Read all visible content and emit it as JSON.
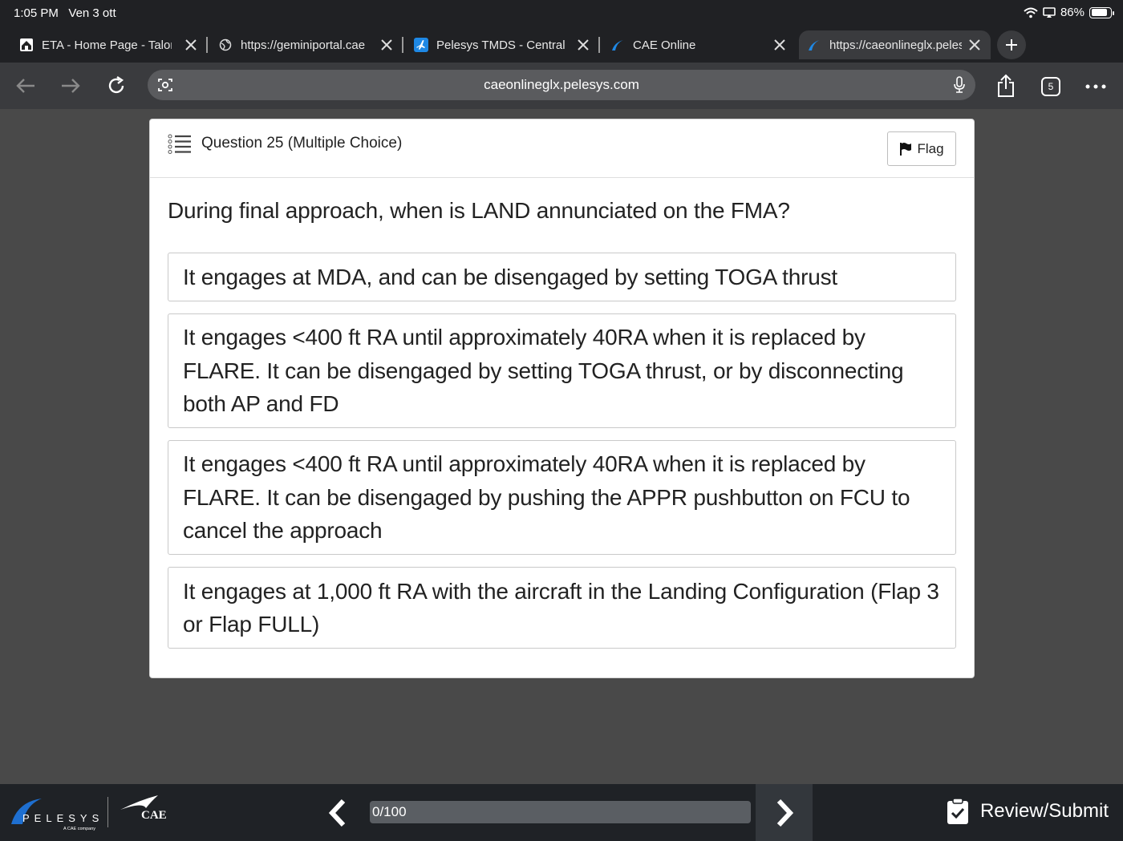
{
  "status_bar": {
    "time": "1:05 PM",
    "date": "Ven 3 ott",
    "battery": "86%",
    "battery_level": 0.86
  },
  "tabs": [
    {
      "title": "ETA - Home Page - Talon",
      "icon": "home-icon",
      "active": false
    },
    {
      "title": "https://geminiportal.cae",
      "icon": "globe-icon",
      "active": false
    },
    {
      "title": "Pelesys TMDS - Central",
      "icon": "plane-icon",
      "active": false
    },
    {
      "title": "CAE Online",
      "icon": "pelesys-icon",
      "active": false
    },
    {
      "title": "https://caeonlineglx.pelesys.com",
      "icon": "pelesys-icon",
      "active": true
    }
  ],
  "toolbar": {
    "url": "caeonlineglx.pelesys.com",
    "tab_count": "5"
  },
  "question": {
    "title": "Question 25 (Multiple Choice)",
    "flag_label": "Flag",
    "text": "During final approach, when is LAND annunciated on the FMA?",
    "options": [
      "It engages at MDA, and can be disengaged by setting TOGA thrust",
      "It engages <400 ft RA until approximately 40RA when it is replaced by FLARE. It can be disengaged by setting TOGA thrust, or by disconnecting both AP and FD",
      "It engages <400 ft RA until approximately 40RA when it is replaced by FLARE. It can be disengaged by pushing the APPR pushbutton on FCU to cancel the approach",
      "It engages at 1,000 ft RA with the aircraft in the Landing Configuration (Flap 3 or Flap FULL)"
    ]
  },
  "footer": {
    "logo_pelesys": "PELESYS",
    "logo_pelesys_sub": "A CAE company",
    "logo_cae": "CAE",
    "progress_text": "0/100",
    "progress_value": 0,
    "review_label": "Review/Submit"
  }
}
